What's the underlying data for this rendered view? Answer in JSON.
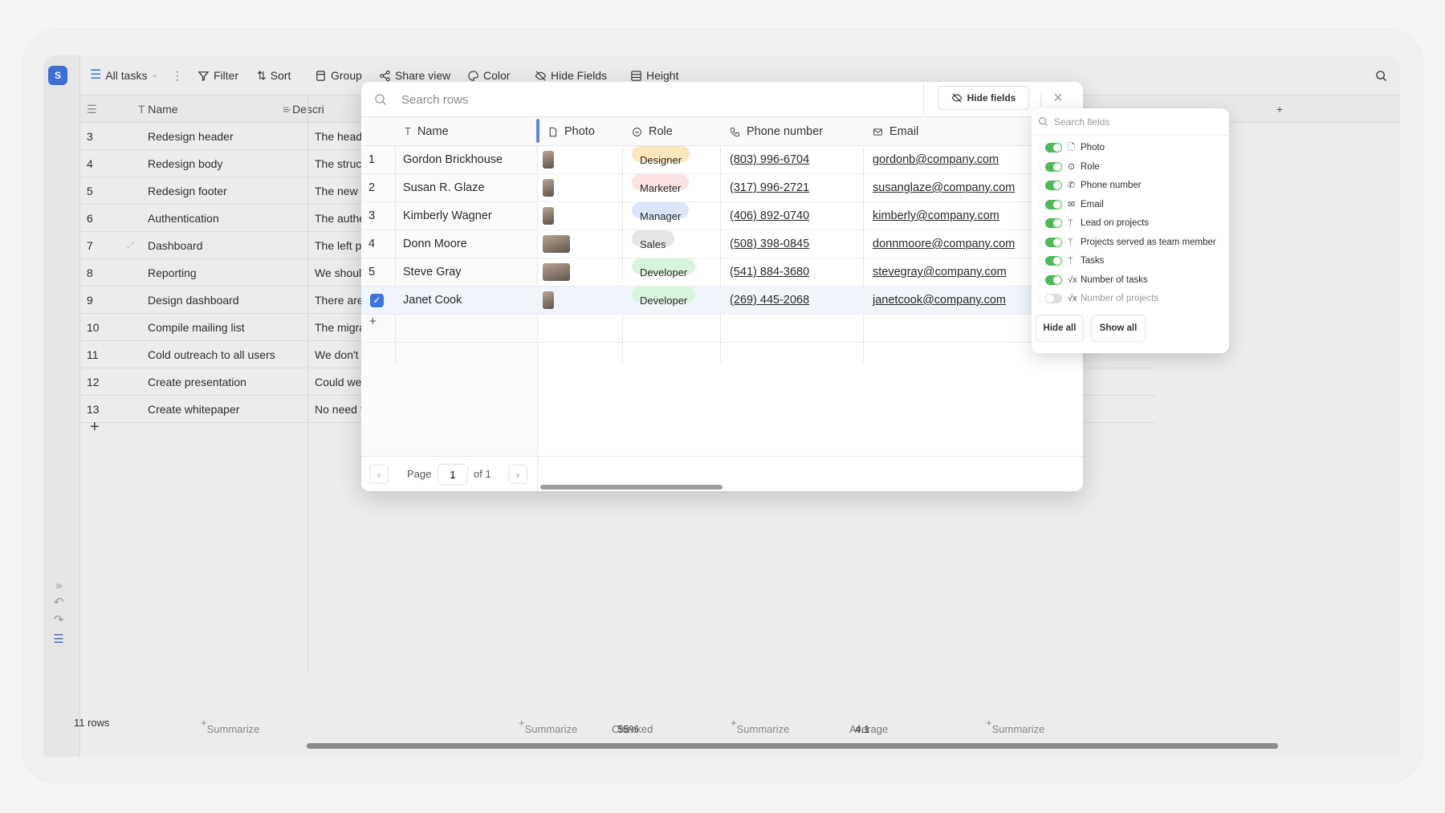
{
  "workspace": {
    "initial": "S"
  },
  "toolbar": {
    "view_name": "All tasks",
    "filter": "Filter",
    "sort": "Sort",
    "group": "Group",
    "share": "Share view",
    "color": "Color",
    "hide_fields": "Hide Fields",
    "height": "Height"
  },
  "grid": {
    "headers": {
      "name": "Name",
      "description": "Descri"
    },
    "rows": [
      {
        "num": "3",
        "name": "Redesign header",
        "desc": "The heade"
      },
      {
        "num": "4",
        "name": "Redesign body",
        "desc": "The struct"
      },
      {
        "num": "5",
        "name": "Redesign footer",
        "desc": "The new f"
      },
      {
        "num": "6",
        "name": "Authentication",
        "desc": "The authe"
      },
      {
        "num": "7",
        "name": "Dashboard",
        "desc": "The left p"
      },
      {
        "num": "8",
        "name": "Reporting",
        "desc": "We should"
      },
      {
        "num": "9",
        "name": "Design dashboard",
        "desc": "There are"
      },
      {
        "num": "10",
        "name": "Compile mailing list",
        "desc": "The migra"
      },
      {
        "num": "11",
        "name": "Cold outreach to all users",
        "desc": "We don't r"
      },
      {
        "num": "12",
        "name": "Create presentation",
        "desc": "Could we"
      },
      {
        "num": "13",
        "name": "Create whitepaper",
        "desc": "No need t"
      }
    ],
    "add_row": "+"
  },
  "footer": {
    "rows_count": "11 rows",
    "summarize": "Summarize",
    "checked_label": "Checked",
    "checked_value": "55%",
    "average_label": "Average",
    "average_value": "4.1"
  },
  "modal": {
    "search_placeholder": "Search rows",
    "hide_fields_btn": "Hide fields",
    "columns": {
      "name": "Name",
      "photo": "Photo",
      "role": "Role",
      "phone": "Phone number",
      "email": "Email"
    },
    "rows": [
      {
        "num": "1",
        "name": "Gordon Brickhouse",
        "role": "Designer",
        "phone": "(803) 996-6704",
        "email": "gordonb@company.com"
      },
      {
        "num": "2",
        "name": "Susan R. Glaze",
        "role": "Marketer",
        "phone": "(317) 996-2721",
        "email": "susanglaze@company.com"
      },
      {
        "num": "3",
        "name": "Kimberly Wagner",
        "role": "Manager",
        "phone": "(406) 892-0740",
        "email": "kimberly@company.com"
      },
      {
        "num": "4",
        "name": "Donn Moore",
        "role": "Sales",
        "phone": "(508) 398-0845",
        "email": "donnmoore@company.com"
      },
      {
        "num": "5",
        "name": "Steve Gray",
        "role": "Developer",
        "phone": "(541) 884-3680",
        "email": "stevegray@company.com"
      },
      {
        "num": "",
        "name": "Janet Cook",
        "role": "Developer",
        "phone": "(269) 445-2068",
        "email": "janetcook@company.com"
      }
    ],
    "add_row": "+",
    "pager": {
      "page_label": "Page",
      "page_value": "1",
      "of_label": "of 1"
    }
  },
  "fields_panel": {
    "search_placeholder": "Search fields",
    "fields": [
      {
        "label": "Photo",
        "on": true
      },
      {
        "label": "Role",
        "on": true
      },
      {
        "label": "Phone number",
        "on": true
      },
      {
        "label": "Email",
        "on": true
      },
      {
        "label": "Lead on projects",
        "on": true
      },
      {
        "label": "Projects served as team member",
        "on": true
      },
      {
        "label": "Tasks",
        "on": true
      },
      {
        "label": "Number of tasks",
        "on": true
      },
      {
        "label": "Number of projects",
        "on": false
      }
    ],
    "hide_all": "Hide all",
    "show_all": "Show all"
  },
  "colors": {
    "accent": "#3c74e0",
    "toggle_on": "#4cbb57",
    "role_designer": "#fbe6bd",
    "role_marketer": "#fbe3e3",
    "role_manager": "#dbe5fb",
    "role_sales": "#e6e6e6",
    "role_developer": "#d8f4de"
  }
}
